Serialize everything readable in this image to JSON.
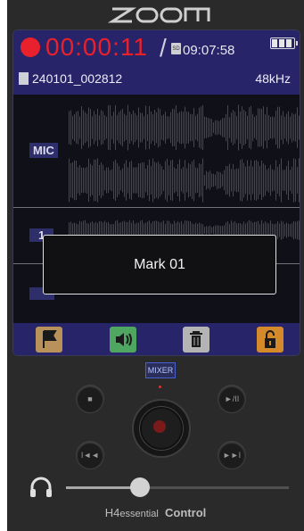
{
  "logo": {
    "text": "zoom"
  },
  "recorder": {
    "elapsed": "00:00:11",
    "separator": "/",
    "sd_label": "SD",
    "remaining": "09:07:58",
    "file_name": "240101_002812",
    "sample_rate": "48kHz"
  },
  "tracks": {
    "mic_label": "MIC",
    "track1_label": "1"
  },
  "popup": {
    "text": "Mark 01"
  },
  "toolbar": {
    "items": [
      {
        "icon": "flag-icon",
        "color": "#b8925a"
      },
      {
        "icon": "speaker-icon",
        "color": "#4fa660"
      },
      {
        "icon": "trash-icon",
        "color": "#b4b4b4"
      },
      {
        "icon": "lock-icon",
        "color": "#d48a2a"
      }
    ]
  },
  "controls": {
    "mixer_label": "MIXER",
    "stop_label": "■",
    "play_pause_label": "►/II",
    "prev_label": "I◄◄",
    "next_label": "►►I",
    "volume": 0.33
  },
  "brand": {
    "h4": "H4",
    "essential": "essential",
    "control": "Control"
  },
  "colors": {
    "rec_red": "#e8212c",
    "header_blue": "#27246a",
    "wave_red": "#b8181c"
  }
}
